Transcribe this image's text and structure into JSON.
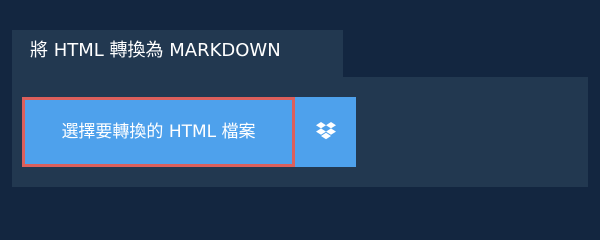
{
  "tab": {
    "title": "將 HTML 轉換為 MARKDOWN"
  },
  "upload": {
    "select_label": "選擇要轉換的 HTML 檔案",
    "dropbox_icon": "dropbox-icon"
  },
  "colors": {
    "background": "#132640",
    "panel": "#223850",
    "button": "#4ea1ec",
    "focus_border": "#dc5f5b",
    "text": "#ffffff"
  }
}
